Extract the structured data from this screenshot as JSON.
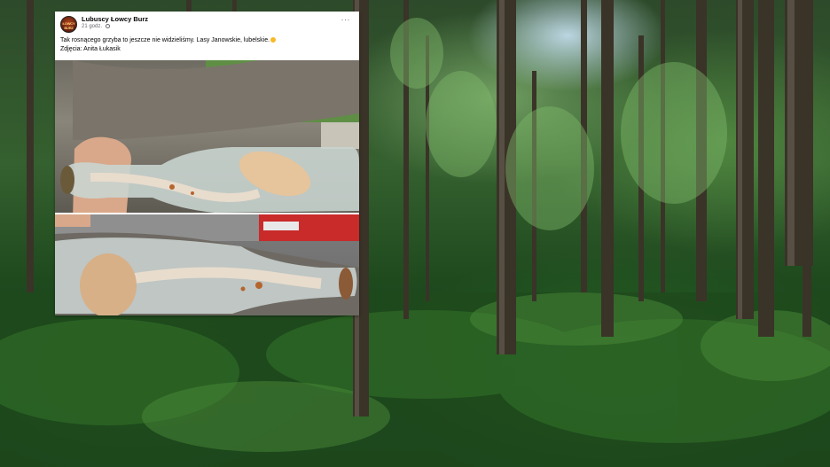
{
  "post": {
    "page_name": "Lubuscy Łowcy Burz",
    "avatar_text": "ŁOWCY BURZ",
    "time": "21 godz.",
    "more_label": "···",
    "text_line1": "Tak rosnącego grzyba to jeszcze nie widzieliśmy. Lasy Janowskie, lubelskie.",
    "text_line2": "Zdjęcia: Anita Łukasik",
    "icons": [
      "globe-icon",
      "emoji-icon",
      "more-icon"
    ]
  },
  "colors": {
    "forest_green": "#2f5a2a",
    "card_background": "#ffffff",
    "meta_gray": "#65676b"
  }
}
